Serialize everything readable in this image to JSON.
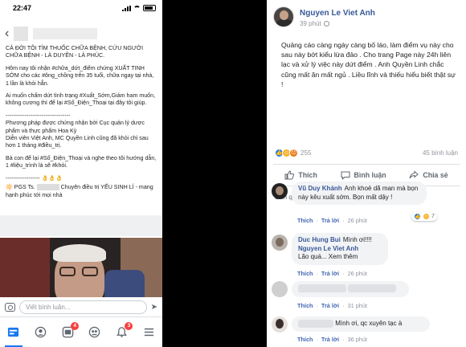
{
  "left_phone": {
    "status": {
      "time": "22:47"
    },
    "post": {
      "paragraphs": [
        "CẢ ĐỜI TÔI TÌM THUỐC CHỮA BỆNH, CỨU NGƯỜI CHỮA BỆNH - LÀ DUYÊN - LÀ PHÚC.",
        "Hôm nay tôi nhận #chữa_dứt_điểm chứng XUẤT TINH SỚM cho các #ông_chồng trên 35 tuổi, chữa ngay tại nhà, 1 lần là khỏi hẳn.",
        "Ai muốn chấm dứt tình trạng #Xuất_Sớm,Giảm ham muốn, không cương thì để lại #Số_Điện_Thoại tại đây tôi giúp.",
        "----------------------------------\nPhương pháp được chứng nhận bởi Cục quản lý dược phẩm và thực phẩm Hoa Kỳ\nDiễn viên Việt Anh, MC Quyền Linh cũng đã khỏi chỉ sau hơn 1 tháng #điều_trị.",
        "Bà con để lại #Số_Điện_Thoại và nghe theo tôi hướng dẫn, 1 #liệu_trình là sẽ #khỏi.",
        "------------------ 👌👌👌"
      ],
      "last_line_prefix": "🔆 PGS Ts.",
      "last_line_suffix": "Chuyên điều trị YẾU SINH LÍ - mang hạnh phúc tới mọi nhà"
    },
    "composer": {
      "placeholder": "Viết bình luận..."
    },
    "nav": {
      "badge_1": "4",
      "badge_2": "3"
    }
  },
  "right_post": {
    "author": "Nguyen Le Viet Anh",
    "time": "39 phút",
    "body": "Quảng cáo càng ngày càng bố láo, làm điểm vụ này cho sau này bớt kiểu lừa đảo . Cho trang Page này 24h liên lạc và xử lý việc này dứt điểm . Anh Quyền Linh chắc cũng mất ăn mất ngủ . Liều lĩnh và thiếu hiểu biết thật sự !",
    "reaction_count": "255",
    "comment_count": "45 bình luận",
    "actions": {
      "like": "Thích",
      "comment": "Bình luận",
      "share": "Chia sẻ"
    },
    "relevance": "Liên quan nhất",
    "comments": [
      {
        "name": "Vũ Duy Khánh",
        "text": "Anh khoẻ dã man mà bọn này kêu xuất sớm. Bọn mất dậy !",
        "like": "Thích",
        "reply": "Trả lời",
        "time": "26 phút",
        "reacts": "7"
      },
      {
        "name": "Duc Hung Bui",
        "text": "Mình ơi!!!!",
        "reply_name": "Nguyen Le Viet Anh",
        "reply_text": "Lão quá... Xem thêm",
        "like": "Thích",
        "reply": "Trả lời",
        "time": "26 phút"
      },
      {
        "like": "Thích",
        "reply": "Trả lời",
        "time": "31 phút"
      },
      {
        "text": "Mình ơi, qc xuyên tạc à",
        "like": "Thích",
        "reply": "Trả lời",
        "time": "36 phút"
      }
    ]
  }
}
